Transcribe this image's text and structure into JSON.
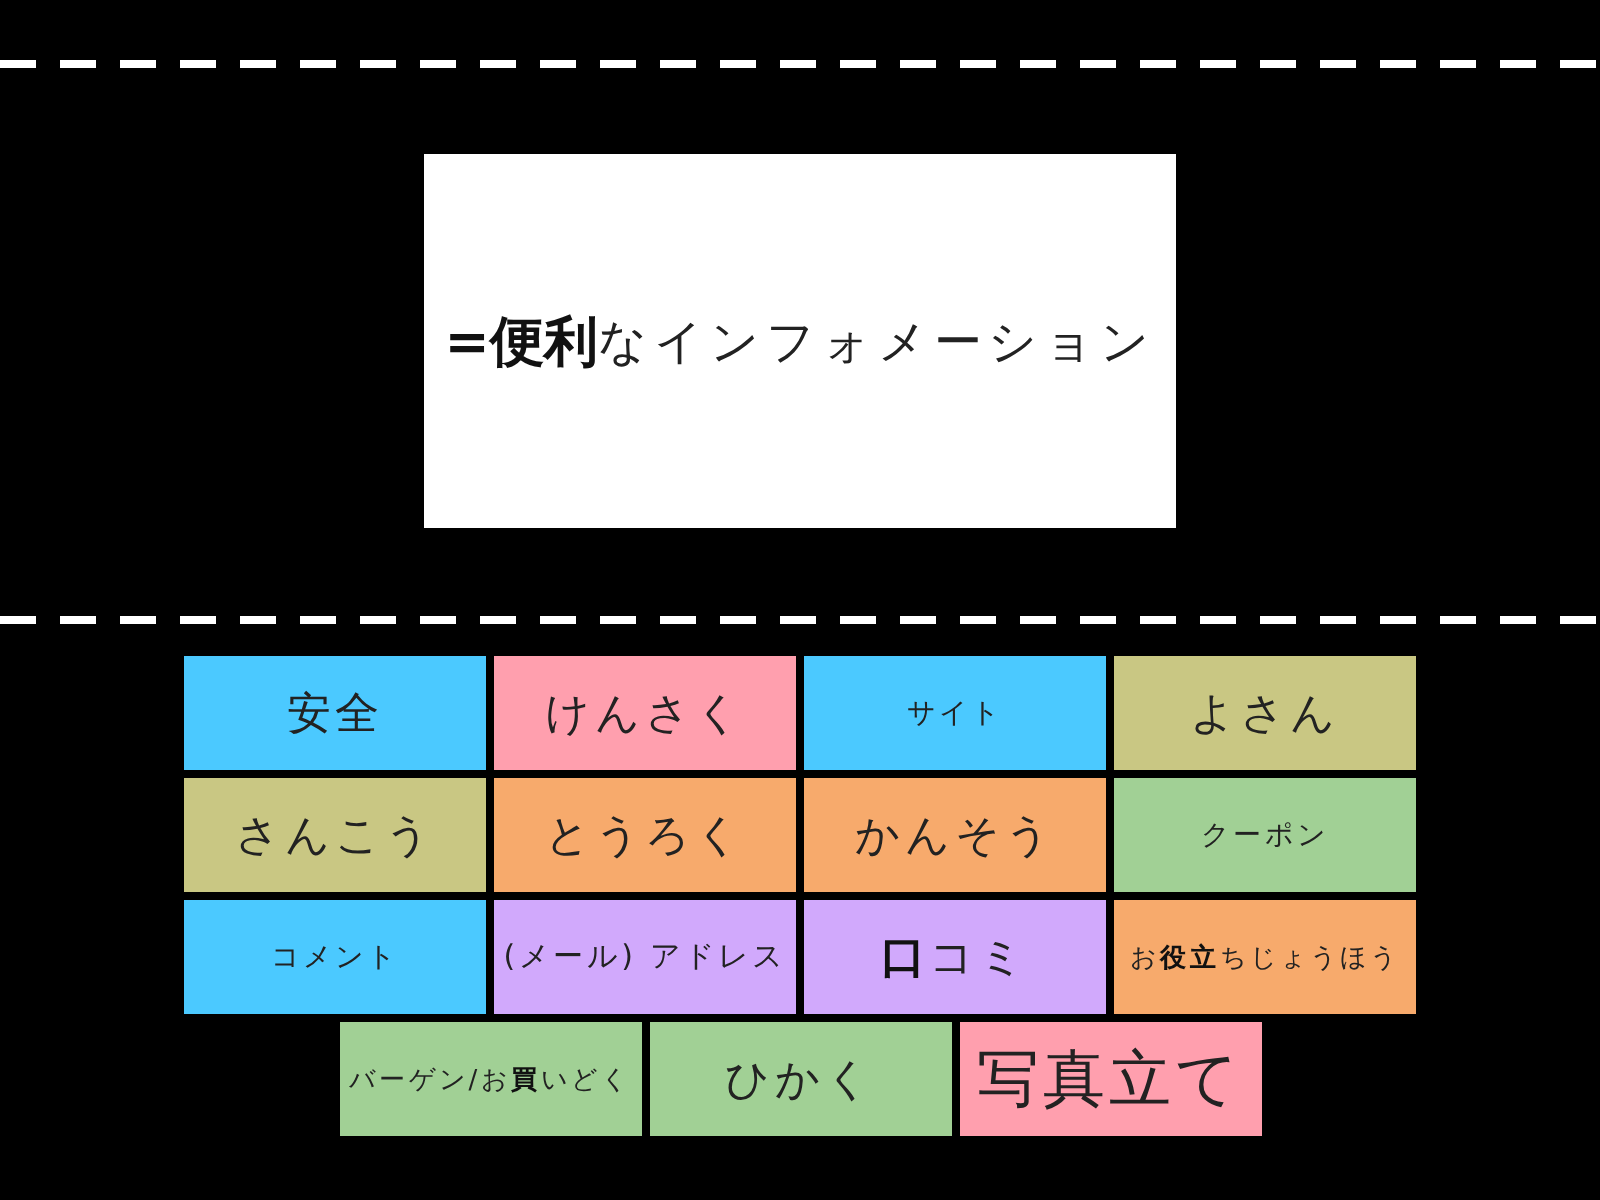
{
  "prompt_card": {
    "text": "**=便利**なインフォメーション"
  },
  "tiles": [
    {
      "label": "安全",
      "color": "#4bc9ff"
    },
    {
      "label": "けんさく",
      "color": "#ff9fae"
    },
    {
      "label": "サイト",
      "color": "#4bc9ff"
    },
    {
      "label": "よさん",
      "color": "#c9c783"
    },
    {
      "label": "さんこう",
      "color": "#c9c783"
    },
    {
      "label": "とうろく",
      "color": "#f7aa6c"
    },
    {
      "label": "かんそう",
      "color": "#f7aa6c"
    },
    {
      "label": "クーポン",
      "color": "#a1d095"
    },
    {
      "label": "コメント",
      "color": "#4bc9ff"
    },
    {
      "label": "(メール) アドレス",
      "color": "#d1a9fc"
    },
    {
      "label": "**口**コミ",
      "color": "#d1a9fc"
    },
    {
      "label": "お**役立**ちじょうほう",
      "color": "#f7aa6c"
    },
    {
      "label": "バーゲン/お**買**いどく",
      "color": "#a1d095"
    },
    {
      "label": "ひかく",
      "color": "#a1d095"
    },
    {
      "label": "写真立て",
      "color": "#ff9fae"
    }
  ]
}
